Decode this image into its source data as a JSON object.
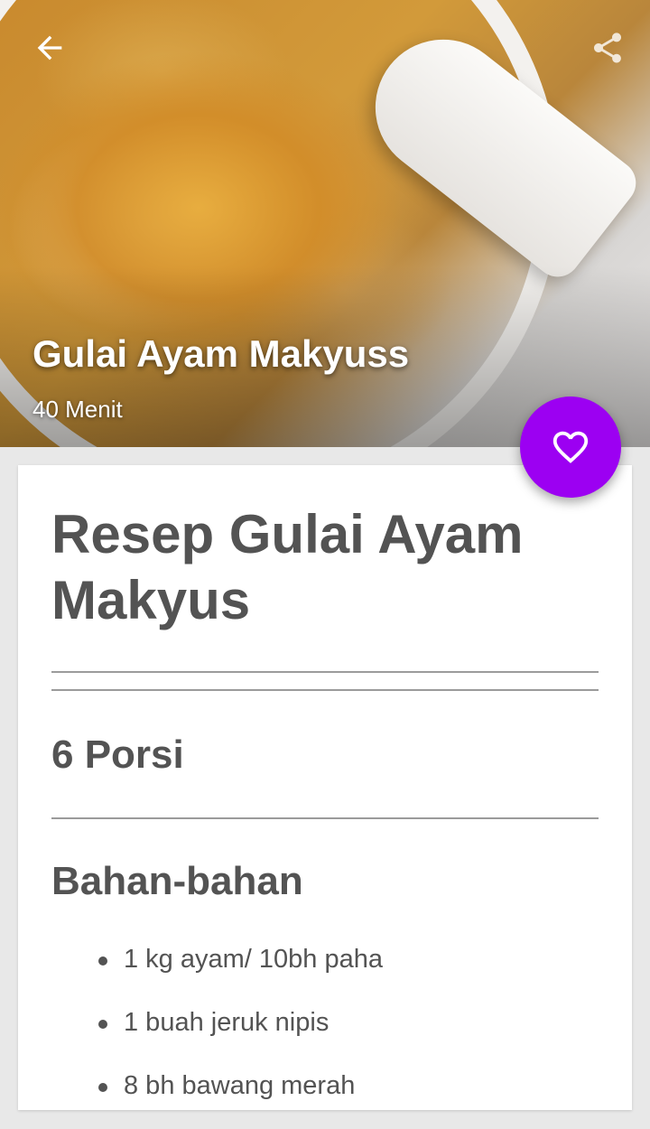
{
  "hero": {
    "title": "Gulai Ayam Makyuss",
    "duration": "40 Menit"
  },
  "toolbar": {
    "back_icon": "arrow-left-icon",
    "share_icon": "share-icon"
  },
  "favorite": {
    "icon": "heart-outline-icon",
    "color": "#9c00f2"
  },
  "recipe": {
    "title": "Resep Gulai Ayam Makyus",
    "servings": "6 Porsi",
    "ingredients_heading": "Bahan-bahan",
    "ingredients": [
      "1 kg ayam/ 10bh paha",
      "1 buah jeruk nipis",
      "8 bh bawang merah"
    ]
  }
}
